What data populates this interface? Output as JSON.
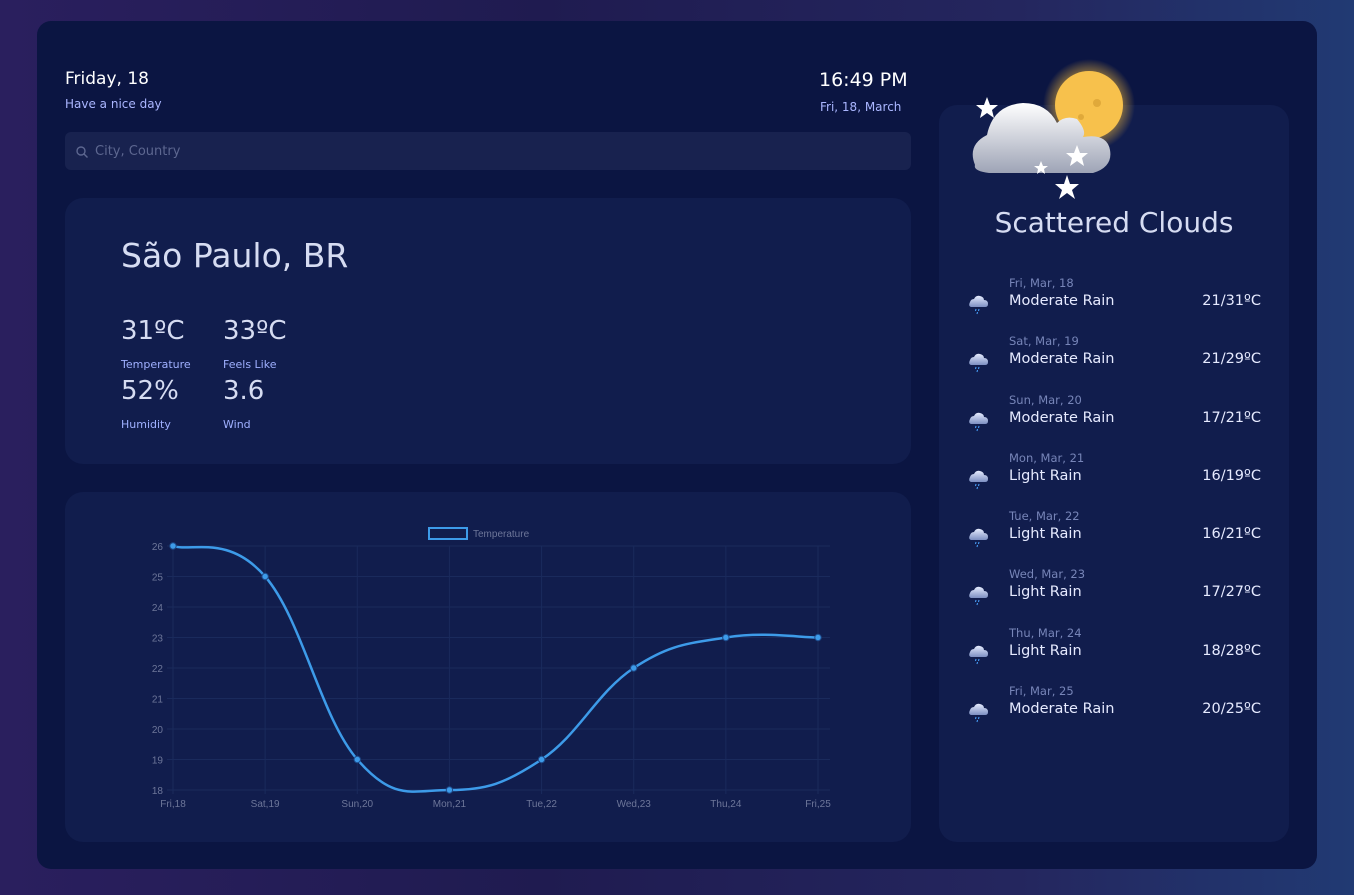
{
  "header": {
    "day": "Friday, 18",
    "greeting": "Have a nice day",
    "time": "16:49 PM",
    "date": "Fri, 18, March"
  },
  "search": {
    "placeholder": "City, Country",
    "value": ""
  },
  "current": {
    "city": "São Paulo, BR",
    "temperature": "31ºC",
    "temperature_label": "Temperature",
    "feels_like": "33ºC",
    "feels_like_label": "Feels Like",
    "humidity": "52%",
    "humidity_label": "Humidity",
    "wind": "3.6",
    "wind_label": "Wind",
    "icon": "cloud-moon-stars-icon"
  },
  "condition": "Scattered Clouds",
  "forecast": [
    {
      "date": "Fri, Mar, 18",
      "desc": "Moderate Rain",
      "temp": "21/31ºC",
      "icon": "rain-cloud-icon"
    },
    {
      "date": "Sat, Mar, 19",
      "desc": "Moderate Rain",
      "temp": "21/29ºC",
      "icon": "rain-cloud-icon"
    },
    {
      "date": "Sun, Mar, 20",
      "desc": "Moderate Rain",
      "temp": "17/21ºC",
      "icon": "rain-cloud-icon"
    },
    {
      "date": "Mon, Mar, 21",
      "desc": "Light Rain",
      "temp": "16/19ºC",
      "icon": "rain-cloud-icon"
    },
    {
      "date": "Tue, Mar, 22",
      "desc": "Light Rain",
      "temp": "16/21ºC",
      "icon": "rain-cloud-icon"
    },
    {
      "date": "Wed, Mar, 23",
      "desc": "Light Rain",
      "temp": "17/27ºC",
      "icon": "rain-cloud-icon"
    },
    {
      "date": "Thu, Mar, 24",
      "desc": "Light Rain",
      "temp": "18/28ºC",
      "icon": "rain-cloud-icon"
    },
    {
      "date": "Fri, Mar, 25",
      "desc": "Moderate Rain",
      "temp": "20/25ºC",
      "icon": "rain-cloud-icon"
    }
  ],
  "colors": {
    "accent": "#3d9be9",
    "background": "#0b1542",
    "card": "#111d4d"
  },
  "chart_data": {
    "type": "line",
    "categories": [
      "Fri,18",
      "Sat,19",
      "Sun,20",
      "Mon,21",
      "Tue,22",
      "Wed,23",
      "Thu,24",
      "Fri,25"
    ],
    "series": [
      {
        "name": "Temperature",
        "values": [
          26,
          25,
          19,
          18,
          19,
          22,
          23,
          23
        ]
      }
    ],
    "ylim": [
      18,
      26
    ],
    "yticks": [
      18,
      19,
      20,
      21,
      22,
      23,
      24,
      25,
      26
    ],
    "legend": "top-center",
    "grid": true
  }
}
